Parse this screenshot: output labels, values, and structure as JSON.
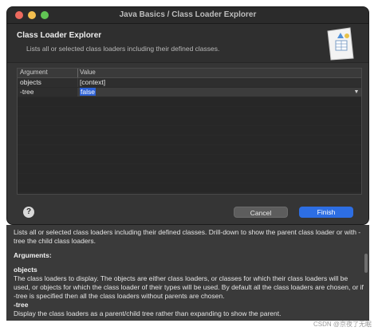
{
  "window": {
    "title": "Java Basics / Class Loader Explorer"
  },
  "header": {
    "title": "Class Loader Explorer",
    "subtitle": "Lists all or selected class loaders including their defined classes."
  },
  "table": {
    "columns": [
      "Argument",
      "Value"
    ],
    "rows": [
      {
        "argument": "objects",
        "value": "[context]"
      },
      {
        "argument": "-tree",
        "value": "false"
      }
    ]
  },
  "buttons": {
    "help": "?",
    "cancel": "Cancel",
    "finish": "Finish"
  },
  "help": {
    "line1": "Lists all or selected class loaders including their defined classes. Drill-down to show the parent class loader or with -tree the child class loaders.",
    "arguments_heading": "Arguments:",
    "objects_heading": "objects",
    "objects_text": "The class loaders to display. The objects are either class loaders, or classes for which their class loaders will be used, or objects for which the class loader of their types will be used. By default all the class loaders are chosen, or if -tree is specified then all the class loaders without parents are chosen.",
    "tree_heading": "-tree",
    "tree_text": "Display the class loaders as a parent/child tree rather than expanding to show the parent."
  },
  "watermark": "CSDN @京夜了无眠",
  "colors": {
    "accent": "#2d6ee3",
    "selection": "#2d61d6",
    "background": "#353535"
  }
}
